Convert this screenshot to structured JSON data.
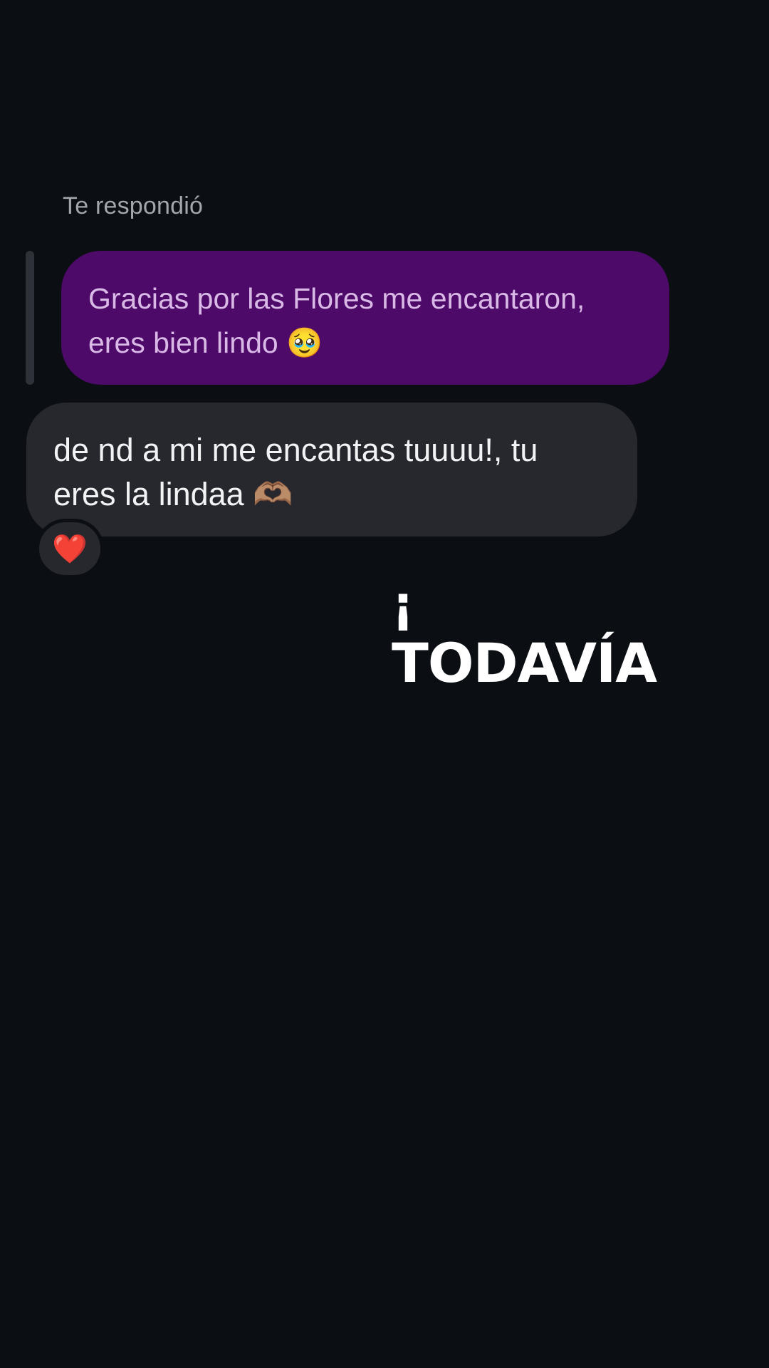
{
  "reply_context": {
    "label": "Te respondió"
  },
  "quoted_message": {
    "text": "Gracias por las Flores me encantaron,\neres bien lindo 🥹",
    "bubble_color": "#4e0a69",
    "text_color": "#d9b9e6"
  },
  "reply_message": {
    "text": "de nd a mi me encantas tuuuu!, tu\neres la lindaa 🫶🏽",
    "bubble_color": "#26282d",
    "text_color": "#f2f3f5",
    "reaction": "❤️"
  },
  "overlay_caption": {
    "line1": "¡",
    "line2": "TODAVÍA"
  },
  "colors": {
    "background": "#0b0f14",
    "reply_bar": "#2e3137"
  }
}
